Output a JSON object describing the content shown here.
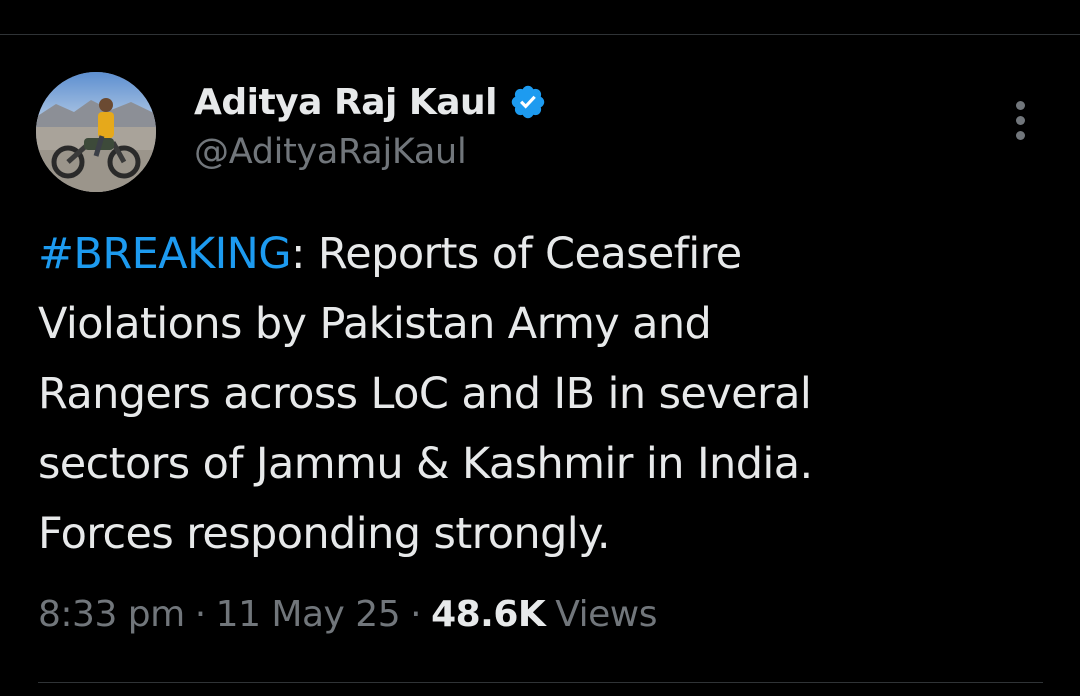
{
  "author": {
    "display_name": "Aditya Raj Kaul",
    "handle": "@AdityaRajKaul",
    "verified": true,
    "verified_badge_icon": "verified-badge-icon",
    "avatar_icon": "avatar-photo-motorcyclist"
  },
  "tweet": {
    "hashtag": "#BREAKING",
    "lines": [
      ": Reports of Ceasefire",
      "Violations by Pakistan Army and",
      "Rangers across LoC and IB in several",
      "sectors of Jammu & Kashmir in India.",
      "Forces responding strongly."
    ]
  },
  "meta": {
    "time": "8:33 pm",
    "separator": "·",
    "date": "11 May 25",
    "views_count": "48.6K",
    "views_label": "Views"
  },
  "colors": {
    "background": "#000000",
    "text_primary": "#e7e9ea",
    "text_secondary": "#71767b",
    "accent": "#1d9bf0",
    "divider": "#2f3336"
  },
  "icons": {
    "more": "more-vertical-icon"
  }
}
